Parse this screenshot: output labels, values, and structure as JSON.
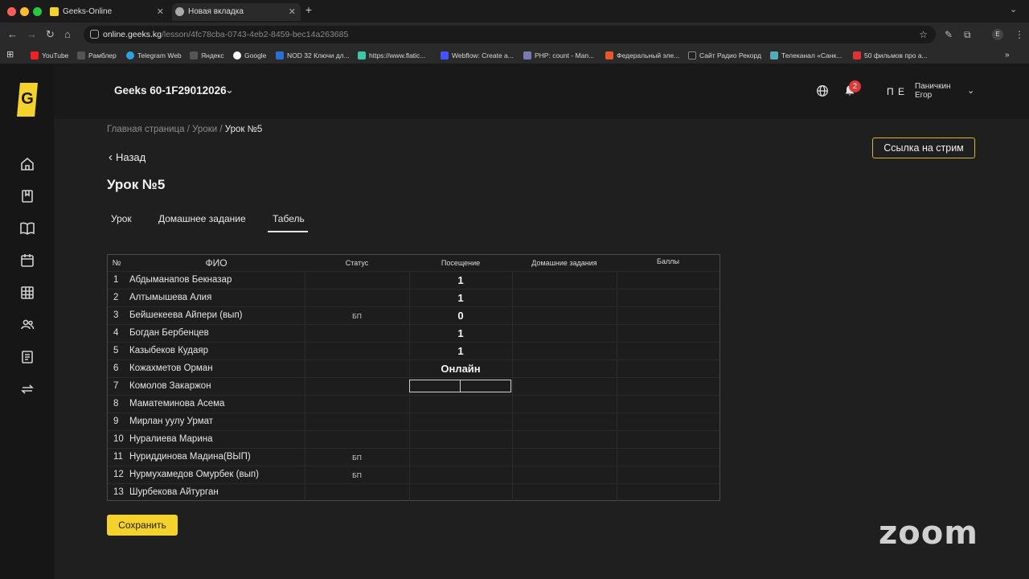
{
  "browser": {
    "tabs": [
      {
        "title": "Geeks-Online",
        "active": false
      },
      {
        "title": "Новая вкладка",
        "active": true
      }
    ],
    "url_host": "online.geeks.kg",
    "url_path": "/lesson/4fc78cba-0743-4eb2-8459-bec14a263685",
    "profile_initial": "E",
    "bookmarks": [
      {
        "label": "YouTube",
        "color": "#e22"
      },
      {
        "label": "Рамблер",
        "color": "#555"
      },
      {
        "label": "Telegram Web",
        "color": "#2aa3e0"
      },
      {
        "label": "Яндекс",
        "color": "#555"
      },
      {
        "label": "Google",
        "color": "#fff"
      },
      {
        "label": "NOD 32 Ключи дл...",
        "color": "#2a6fd6"
      },
      {
        "label": "https://www.flatic...",
        "color": "#3ec6a8"
      },
      {
        "label": "Webflow: Create a...",
        "color": "#4353ff"
      },
      {
        "label": "PHP: count - Man...",
        "color": "#777bb3"
      },
      {
        "label": "Федеральный эле...",
        "color": "#e8572a"
      },
      {
        "label": "Сайт Радио Рекорд",
        "color": "#222"
      },
      {
        "label": "Телеканал «Санк...",
        "color": "#5ab"
      },
      {
        "label": "50 фильмов про а...",
        "color": "#d33"
      }
    ]
  },
  "header": {
    "group": "Geeks 60-1F29012026",
    "notifications_count": "2",
    "user_initials": "П Е",
    "user_last_name": "Паничкин",
    "user_first_name": "Егор"
  },
  "breadcrumb": {
    "home": "Главная страница",
    "sep1": " / ",
    "lessons": "Уроки",
    "sep2": " / ",
    "current": "Урок №5"
  },
  "page": {
    "back_label": "Назад",
    "title": "Урок №5",
    "stream_button": "Ссылка на стрим",
    "tabs": [
      "Урок",
      "Домашнее задание",
      "Табель"
    ],
    "active_tab": "Табель",
    "save_button": "Сохранить"
  },
  "table": {
    "headers": {
      "num": "№",
      "fio": "ФИО",
      "status": "Статус",
      "attendance": "Посещение",
      "homework": "Домашние задания",
      "score": "Баллы"
    },
    "rows": [
      {
        "num": "1",
        "name": "Абдыманапов Бекназар",
        "status": "",
        "attendance": "1"
      },
      {
        "num": "2",
        "name": "Алтымышева Алия",
        "status": "",
        "attendance": "1"
      },
      {
        "num": "3",
        "name": "Бейшекеева Айпери (вып)",
        "status": "БП",
        "attendance": "0"
      },
      {
        "num": "4",
        "name": "Богдан Бербенцев",
        "status": "",
        "attendance": "1"
      },
      {
        "num": "5",
        "name": "Казыбеков Кудаяр",
        "status": "",
        "attendance": "1"
      },
      {
        "num": "6",
        "name": "Кожахметов Орман",
        "status": "",
        "attendance": "Онлайн"
      },
      {
        "num": "7",
        "name": "Комолов Закаржон",
        "status": "",
        "attendance": ""
      },
      {
        "num": "8",
        "name": "Маматеминова Асема",
        "status": "",
        "attendance": ""
      },
      {
        "num": "9",
        "name": "Мирлан уулу Урмат",
        "status": "",
        "attendance": ""
      },
      {
        "num": "10",
        "name": "Нуралиева Марина",
        "status": "",
        "attendance": ""
      },
      {
        "num": "11",
        "name": "Нуриддинова Мадина(ВЫП)",
        "status": "БП",
        "attendance": ""
      },
      {
        "num": "12",
        "name": "Нурмухамедов Омурбек (вып)",
        "status": "БП",
        "attendance": ""
      },
      {
        "num": "13",
        "name": "Шурбекова Айтурган",
        "status": "",
        "attendance": ""
      }
    ]
  },
  "overlay": {
    "zoom_watermark": "zoom"
  },
  "colors": {
    "accent": "#f5d22b",
    "badge": "#d93a3a",
    "background": "#1f1f1f"
  }
}
